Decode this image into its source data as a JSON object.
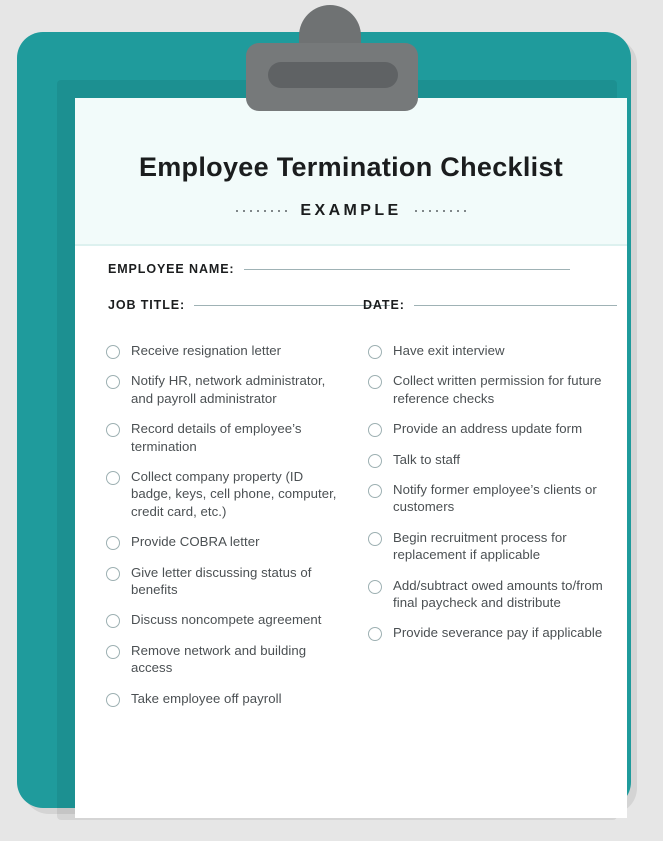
{
  "theme": {
    "background": "#e6e6e6",
    "board_teal": "#1f9b9c",
    "paper": "#ffffff",
    "header_band": "#f2fbfa",
    "clip_gray": "#76797a",
    "clip_slot_gray": "#5f6264",
    "title_color": "#1b1d1e",
    "body_text_color": "#4b5053",
    "rule_color": "#9fb2b5",
    "checkbox_border": "#9db0b2"
  },
  "header": {
    "title": "Employee Termination Checklist",
    "example_label": "EXAMPLE",
    "dots_left_count": 8,
    "dots_right_count": 8
  },
  "form": {
    "employee_name_label": "EMPLOYEE NAME:",
    "employee_name_value": "",
    "job_title_label": "JOB TITLE:",
    "job_title_value": "",
    "date_label": "DATE:",
    "date_value": ""
  },
  "checklist": {
    "left_column": [
      {
        "label": "Receive resignation letter",
        "checked": false
      },
      {
        "label": "Notify HR, network administrator, and payroll administrator",
        "checked": false
      },
      {
        "label": "Record details of employee’s termination",
        "checked": false
      },
      {
        "label": "Collect company property (ID badge, keys, cell phone, computer, credit card, etc.)",
        "checked": false
      },
      {
        "label": "Provide COBRA letter",
        "checked": false
      },
      {
        "label": "Give letter discussing status of benefits",
        "checked": false
      },
      {
        "label": "Discuss noncompete agreement",
        "checked": false
      },
      {
        "label": "Remove network and building access",
        "checked": false
      },
      {
        "label": "Take employee off payroll",
        "checked": false
      }
    ],
    "right_column": [
      {
        "label": "Have exit interview",
        "checked": false
      },
      {
        "label": "Collect written permission for future reference checks",
        "checked": false
      },
      {
        "label": "Provide an address update form",
        "checked": false
      },
      {
        "label": "Talk to staff",
        "checked": false
      },
      {
        "label": "Notify former employee’s clients or customers",
        "checked": false
      },
      {
        "label": "Begin recruitment process for replacement if applicable",
        "checked": false
      },
      {
        "label": "Add/subtract owed amounts to/from final paycheck and distribute",
        "checked": false
      },
      {
        "label": "Provide severance pay if applicable",
        "checked": false
      }
    ]
  },
  "clip": {
    "icon": "clipboard-clip-icon"
  }
}
